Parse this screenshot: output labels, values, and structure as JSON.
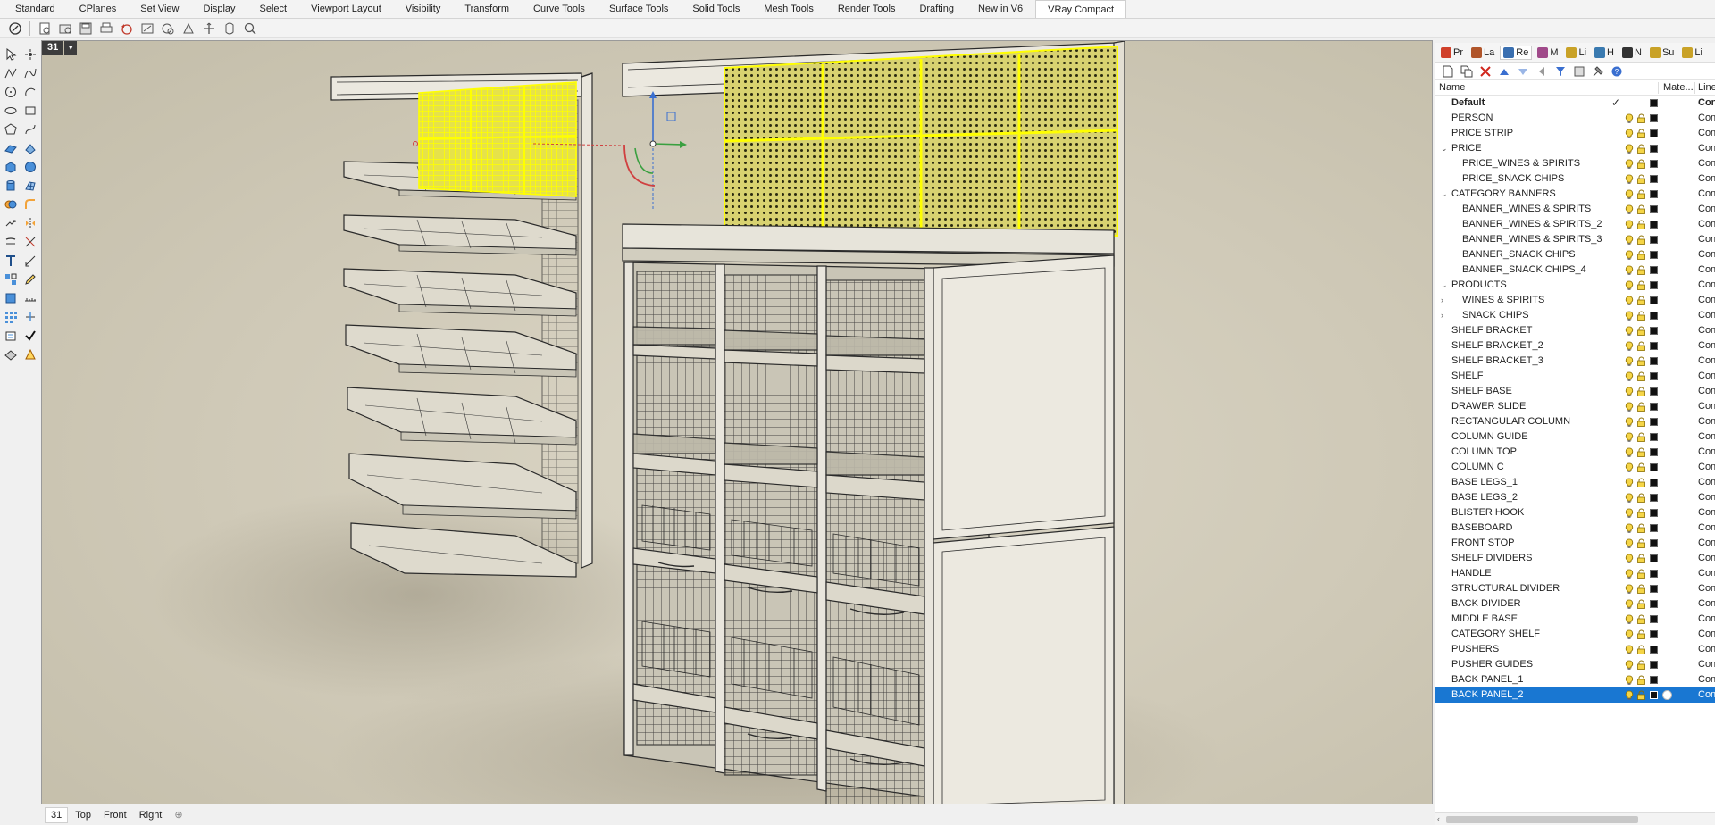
{
  "tabs": [
    {
      "label": "Standard",
      "active": false
    },
    {
      "label": "CPlanes",
      "active": false
    },
    {
      "label": "Set View",
      "active": false
    },
    {
      "label": "Display",
      "active": false
    },
    {
      "label": "Select",
      "active": false
    },
    {
      "label": "Viewport Layout",
      "active": false
    },
    {
      "label": "Visibility",
      "active": false
    },
    {
      "label": "Transform",
      "active": false
    },
    {
      "label": "Curve Tools",
      "active": false
    },
    {
      "label": "Surface Tools",
      "active": false
    },
    {
      "label": "Solid Tools",
      "active": false
    },
    {
      "label": "Mesh Tools",
      "active": false
    },
    {
      "label": "Render Tools",
      "active": false
    },
    {
      "label": "Drafting",
      "active": false
    },
    {
      "label": "New in V6",
      "active": false
    },
    {
      "label": "VRay Compact",
      "active": true
    }
  ],
  "viewport": {
    "title": "31",
    "dropdown_glyph": "▼",
    "tabs": [
      {
        "label": "31",
        "active": true
      },
      {
        "label": "Top",
        "active": false
      },
      {
        "label": "Front",
        "active": false
      },
      {
        "label": "Right",
        "active": false
      }
    ],
    "add_glyph": "⊕"
  },
  "panel": {
    "tabs": [
      {
        "label": "Pr",
        "color": "#d0402a"
      },
      {
        "label": "La",
        "color": "#b0552a"
      },
      {
        "label": "Re",
        "color": "#3a6fb0"
      },
      {
        "label": "M",
        "color": "#a04a8a"
      },
      {
        "label": "Li",
        "color": "#c9a227"
      },
      {
        "label": "H",
        "color": "#3a7ab0"
      },
      {
        "label": "N",
        "color": "#333333"
      },
      {
        "label": "Su",
        "color": "#c9a227"
      },
      {
        "label": "Li",
        "color": "#c9a227"
      }
    ],
    "columns": {
      "name": "Name",
      "material": "Mate...",
      "linetype": "Line"
    },
    "line_text": "Con",
    "layers": [
      {
        "name": "Default",
        "indent": 0,
        "bold": true,
        "current": true,
        "check": "✓",
        "expander": "",
        "selected": false
      },
      {
        "name": "PERSON",
        "indent": 0,
        "expander": "",
        "selected": false
      },
      {
        "name": "PRICE STRIP",
        "indent": 0,
        "expander": "",
        "selected": false
      },
      {
        "name": "PRICE",
        "indent": 0,
        "expander": "⌄",
        "selected": false
      },
      {
        "name": "PRICE_WINES & SPIRITS",
        "indent": 1,
        "expander": "",
        "selected": false
      },
      {
        "name": "PRICE_SNACK CHIPS",
        "indent": 1,
        "expander": "",
        "selected": false
      },
      {
        "name": "CATEGORY BANNERS",
        "indent": 0,
        "expander": "⌄",
        "selected": false
      },
      {
        "name": "BANNER_WINES & SPIRITS",
        "indent": 1,
        "expander": "",
        "selected": false
      },
      {
        "name": "BANNER_WINES & SPIRITS_2",
        "indent": 1,
        "expander": "",
        "selected": false
      },
      {
        "name": "BANNER_WINES & SPIRITS_3",
        "indent": 1,
        "expander": "",
        "selected": false
      },
      {
        "name": "BANNER_SNACK CHIPS",
        "indent": 1,
        "expander": "",
        "selected": false
      },
      {
        "name": "BANNER_SNACK CHIPS_4",
        "indent": 1,
        "expander": "",
        "selected": false
      },
      {
        "name": "PRODUCTS",
        "indent": 0,
        "expander": "⌄",
        "selected": false
      },
      {
        "name": "WINES & SPIRITS",
        "indent": 1,
        "expander": "›",
        "selected": false
      },
      {
        "name": "SNACK CHIPS",
        "indent": 1,
        "expander": "›",
        "selected": false
      },
      {
        "name": "SHELF BRACKET",
        "indent": 0,
        "expander": "",
        "selected": false
      },
      {
        "name": "SHELF BRACKET_2",
        "indent": 0,
        "expander": "",
        "selected": false
      },
      {
        "name": "SHELF BRACKET_3",
        "indent": 0,
        "expander": "",
        "selected": false
      },
      {
        "name": "SHELF",
        "indent": 0,
        "expander": "",
        "selected": false
      },
      {
        "name": "SHELF BASE",
        "indent": 0,
        "expander": "",
        "selected": false
      },
      {
        "name": "DRAWER SLIDE",
        "indent": 0,
        "expander": "",
        "selected": false
      },
      {
        "name": "RECTANGULAR COLUMN",
        "indent": 0,
        "expander": "",
        "selected": false
      },
      {
        "name": "COLUMN GUIDE",
        "indent": 0,
        "expander": "",
        "selected": false
      },
      {
        "name": "COLUMN TOP",
        "indent": 0,
        "expander": "",
        "selected": false
      },
      {
        "name": "COLUMN C",
        "indent": 0,
        "expander": "",
        "selected": false
      },
      {
        "name": "BASE LEGS_1",
        "indent": 0,
        "expander": "",
        "selected": false
      },
      {
        "name": "BASE LEGS_2",
        "indent": 0,
        "expander": "",
        "selected": false
      },
      {
        "name": "BLISTER HOOK",
        "indent": 0,
        "expander": "",
        "selected": false
      },
      {
        "name": "BASEBOARD",
        "indent": 0,
        "expander": "",
        "selected": false
      },
      {
        "name": "FRONT STOP",
        "indent": 0,
        "expander": "",
        "selected": false
      },
      {
        "name": "SHELF DIVIDERS",
        "indent": 0,
        "expander": "",
        "selected": false
      },
      {
        "name": "HANDLE",
        "indent": 0,
        "expander": "",
        "selected": false
      },
      {
        "name": "STRUCTURAL DIVIDER",
        "indent": 0,
        "expander": "",
        "selected": false
      },
      {
        "name": "BACK DIVIDER",
        "indent": 0,
        "expander": "",
        "selected": false
      },
      {
        "name": "MIDDLE BASE",
        "indent": 0,
        "expander": "",
        "selected": false
      },
      {
        "name": "CATEGORY SHELF",
        "indent": 0,
        "expander": "",
        "selected": false
      },
      {
        "name": "PUSHERS",
        "indent": 0,
        "expander": "",
        "selected": false
      },
      {
        "name": "PUSHER GUIDES",
        "indent": 0,
        "expander": "",
        "selected": false
      },
      {
        "name": "BACK PANEL_1",
        "indent": 0,
        "expander": "",
        "selected": false
      },
      {
        "name": "BACK PANEL_2",
        "indent": 0,
        "expander": "",
        "selected": true
      }
    ]
  },
  "colors": {
    "selection": "#1977d2",
    "highlight_yellow": "#ffff00",
    "viewport_bg": "#d4cfbf"
  }
}
